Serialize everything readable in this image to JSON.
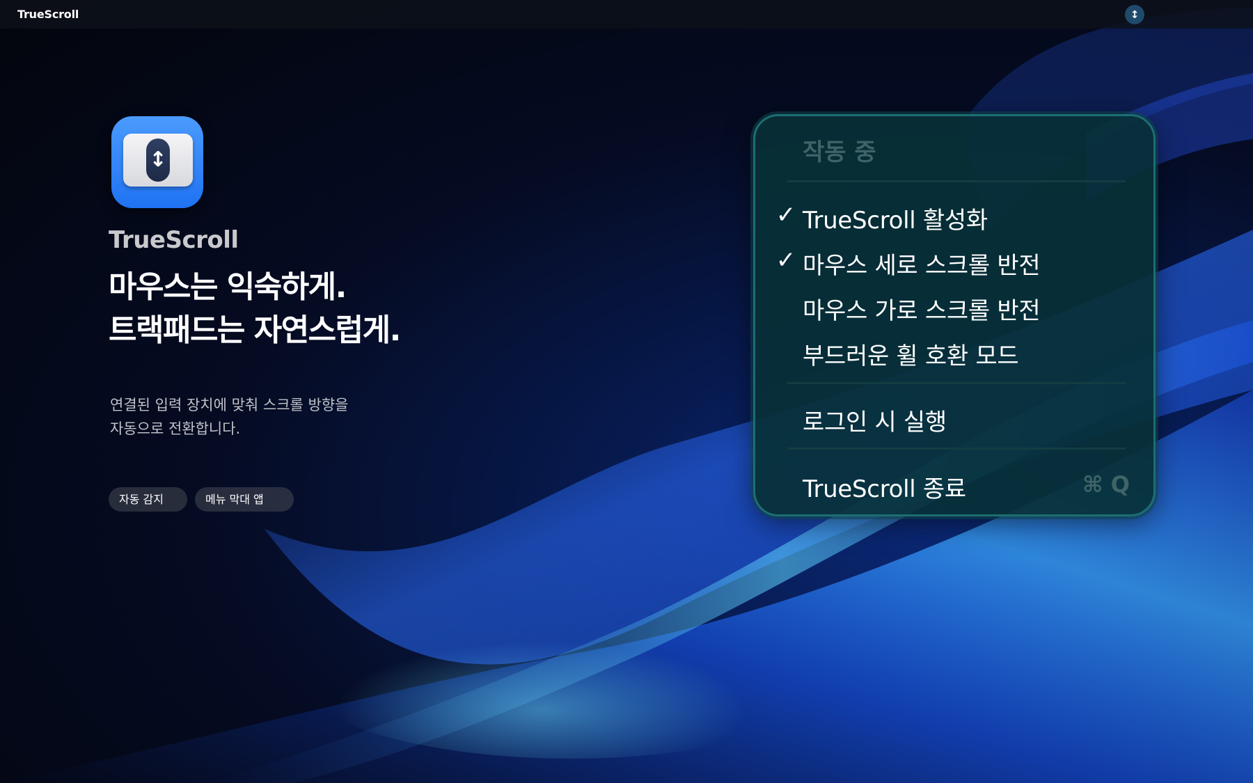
{
  "menubar": {
    "app_title": "TrueScroll",
    "status_icon": "arrow-up-down-icon",
    "status_glyph": "↕"
  },
  "hero": {
    "app_icon": "scroll-app-icon",
    "app_icon_glyph": "↕",
    "app_name": "TrueScroll",
    "headline_line1": "마우스는 익숙하게.",
    "headline_line2": "트랙패드는 자연스럽게.",
    "description_line1": "연결된 입력 장치에 맞춰 스크롤 방향을",
    "description_line2": "자동으로 전환합니다.",
    "tags": [
      "자동 감지",
      "메뉴 막대 앱"
    ]
  },
  "menu": {
    "header": "작동 중",
    "items": [
      {
        "label": "TrueScroll 활성화",
        "checked": true,
        "check_glyph": "✓"
      },
      {
        "label": "마우스 세로 스크롤 반전",
        "checked": true,
        "check_glyph": "✓"
      },
      {
        "label": "마우스 가로 스크롤 반전",
        "checked": false,
        "check_glyph": ""
      },
      {
        "label": "부드러운 휠 호환 모드",
        "checked": false,
        "check_glyph": ""
      },
      {
        "label": "로그인 시 실행",
        "checked": false,
        "check_glyph": ""
      },
      {
        "label": "TrueScroll 종료",
        "checked": false,
        "check_glyph": "",
        "shortcut": "⌘ Q"
      }
    ]
  },
  "colors": {
    "menu_background": "#083036",
    "menu_border": "#1c6e72",
    "menu_disabled_text": "#3f6467",
    "accent_blue": "#1f72f2"
  }
}
